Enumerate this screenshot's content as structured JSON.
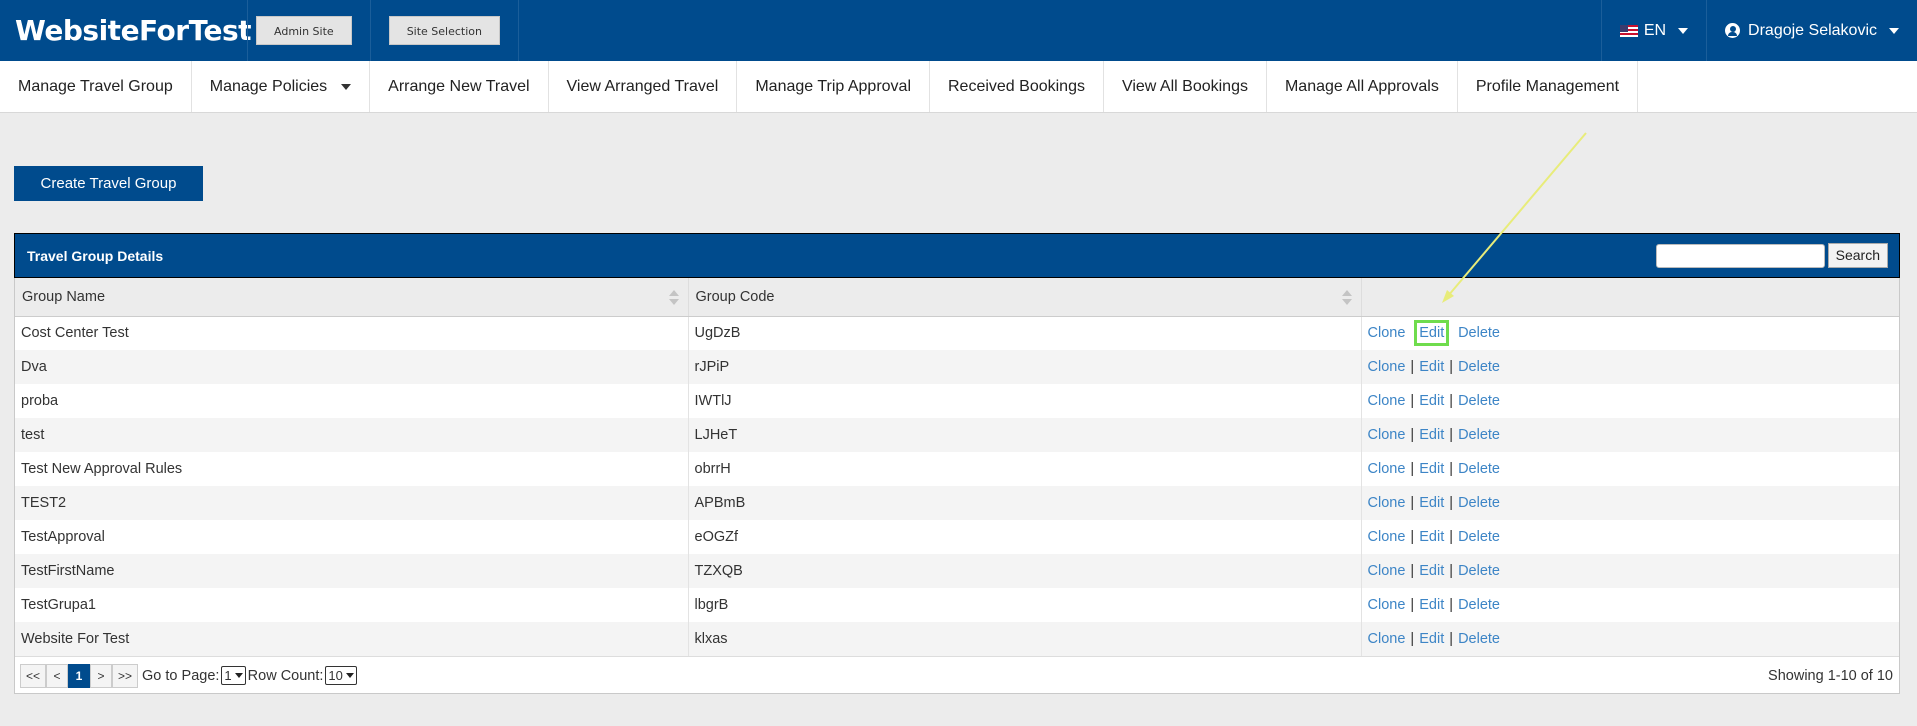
{
  "header": {
    "brand": "WebsiteForTest",
    "admin_site_label": "Admin Site",
    "site_selection_label": "Site Selection",
    "language": "EN",
    "user_name": "Dragoje Selakovic"
  },
  "nav": {
    "items": [
      {
        "label": "Manage Travel Group"
      },
      {
        "label": "Manage Policies"
      },
      {
        "label": "Arrange New Travel"
      },
      {
        "label": "View Arranged Travel"
      },
      {
        "label": "Manage Trip Approval"
      },
      {
        "label": "Received Bookings"
      },
      {
        "label": "View All Bookings"
      },
      {
        "label": "Manage All Approvals"
      },
      {
        "label": "Profile Management"
      }
    ]
  },
  "page": {
    "create_button": "Create Travel Group"
  },
  "panel": {
    "title": "Travel Group Details",
    "search_placeholder": "",
    "search_button": "Search",
    "columns": [
      "Group Name",
      "Group Code",
      ""
    ],
    "actions": {
      "clone": "Clone",
      "edit": "Edit",
      "delete": "Delete",
      "separator": "|"
    },
    "rows": [
      {
        "name": "Cost Center Test",
        "code": "UgDzB"
      },
      {
        "name": "Dva",
        "code": "rJPiP"
      },
      {
        "name": "proba",
        "code": "IWTlJ"
      },
      {
        "name": "test",
        "code": "LJHeT"
      },
      {
        "name": "Test New Approval Rules",
        "code": "obrrH"
      },
      {
        "name": "TEST2",
        "code": "APBmB"
      },
      {
        "name": "TestApproval",
        "code": "eOGZf"
      },
      {
        "name": "TestFirstName",
        "code": "TZXQB"
      },
      {
        "name": "TestGrupa1",
        "code": "lbgrB"
      },
      {
        "name": "Website For Test",
        "code": "klxas"
      }
    ]
  },
  "pager": {
    "first": "<<",
    "prev": "<",
    "current": "1",
    "next": ">",
    "last": ">>",
    "go_to_page_label": "Go to Page:",
    "go_to_page_value": "1",
    "row_count_label": "Row Count:",
    "row_count_value": "10",
    "showing": "Showing 1-10 of 10"
  },
  "annotation": {
    "highlight_color": "#6fdc4d",
    "arrow_color": "#e8ec7a"
  }
}
